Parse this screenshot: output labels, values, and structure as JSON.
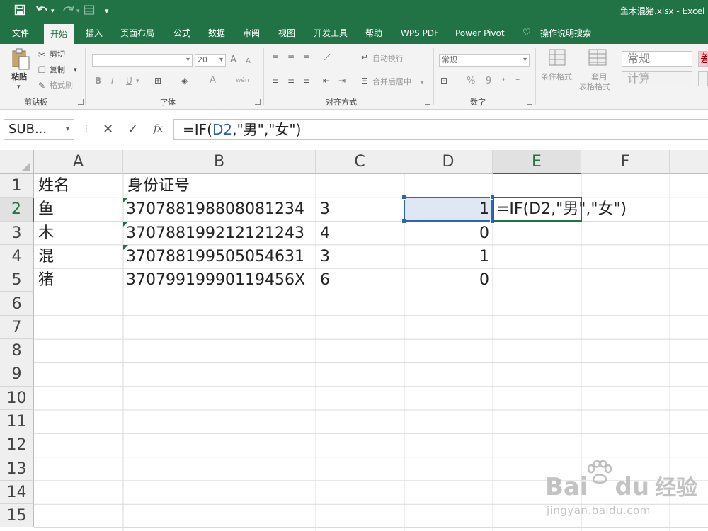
{
  "window": {
    "title": "鱼木混猪.xlsx  -  Excel"
  },
  "quick_access": {
    "save_icon": "save-icon",
    "undo_icon": "undo-icon",
    "redo_icon": "redo-icon",
    "customize_icon": "customize-icon"
  },
  "tabs": [
    {
      "label": "文件"
    },
    {
      "label": "开始"
    },
    {
      "label": "插入"
    },
    {
      "label": "页面布局"
    },
    {
      "label": "公式"
    },
    {
      "label": "数据"
    },
    {
      "label": "审阅"
    },
    {
      "label": "视图"
    },
    {
      "label": "开发工具"
    },
    {
      "label": "帮助"
    },
    {
      "label": "WPS PDF"
    },
    {
      "label": "Power Pivot"
    },
    {
      "label": "操作说明搜索"
    }
  ],
  "ribbon": {
    "clipboard": {
      "paste": "粘贴",
      "cut": "剪切",
      "copy": "复制",
      "format_painter": "格式刷",
      "group": "剪贴板"
    },
    "font": {
      "font_name": "",
      "font_size": "20",
      "bold": "B",
      "italic": "I",
      "underline": "U",
      "group": "字体",
      "grow": "A",
      "shrink": "A",
      "color": "A",
      "phonetic": "wén"
    },
    "alignment": {
      "wrap": "自动换行",
      "merge": "合并后居中",
      "group": "对齐方式"
    },
    "number": {
      "format": "常规",
      "percent": "%",
      "comma": "9",
      "group": "数字"
    },
    "styles": {
      "conditional": "条件格式",
      "table1": "套用",
      "table2": "表格格式",
      "normal": "常规",
      "calc": "计算",
      "bad": "差"
    }
  },
  "formula_bar": {
    "name_box": "SUB...",
    "formula_prefix": "=IF(",
    "formula_ref": "D2",
    "formula_suffix": ",\"男\",\"女\")"
  },
  "sheet": {
    "columns": [
      "A",
      "B",
      "C",
      "D",
      "E",
      "F"
    ],
    "rows": [
      "1",
      "2",
      "3",
      "4",
      "5",
      "6",
      "7",
      "8",
      "9",
      "10",
      "11",
      "12",
      "13",
      "14",
      "15"
    ],
    "cells": {
      "A1": "姓名",
      "B1": "身份证号",
      "A2": "鱼",
      "B2": "370788198808081234",
      "C2": "3",
      "D2": "1",
      "A3": "木",
      "B3": "370788199212121243",
      "C3": "4",
      "D3": "0",
      "A4": "混",
      "B4": "370788199505054631",
      "C4": "3",
      "D4": "1",
      "A5": "猪",
      "B5": "37079919990119456X",
      "C5": "6",
      "D5": "0"
    },
    "editing_cell_text": "=IF(D2,\"男\",\"女\")"
  },
  "watermark": {
    "brand": "Bai",
    "brand2": "du",
    "cn": "经验",
    "url": "jingyan.baidu.com"
  }
}
